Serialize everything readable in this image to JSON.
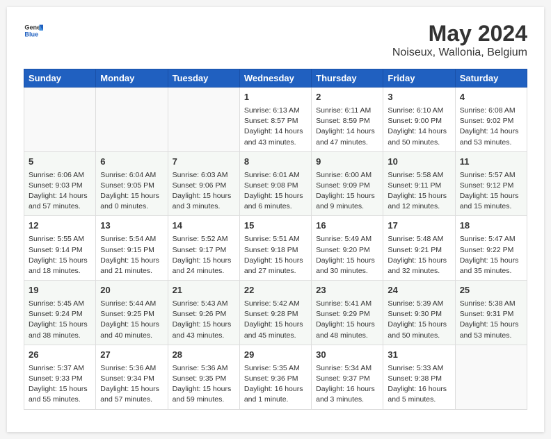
{
  "header": {
    "logo_general": "General",
    "logo_blue": "Blue",
    "title": "May 2024",
    "subtitle": "Noiseux, Wallonia, Belgium"
  },
  "days_of_week": [
    "Sunday",
    "Monday",
    "Tuesday",
    "Wednesday",
    "Thursday",
    "Friday",
    "Saturday"
  ],
  "weeks": [
    {
      "cells": [
        {
          "empty": true
        },
        {
          "empty": true
        },
        {
          "empty": true
        },
        {
          "day": 1,
          "sunrise": "6:13 AM",
          "sunset": "8:57 PM",
          "daylight": "14 hours and 43 minutes."
        },
        {
          "day": 2,
          "sunrise": "6:11 AM",
          "sunset": "8:59 PM",
          "daylight": "14 hours and 47 minutes."
        },
        {
          "day": 3,
          "sunrise": "6:10 AM",
          "sunset": "9:00 PM",
          "daylight": "14 hours and 50 minutes."
        },
        {
          "day": 4,
          "sunrise": "6:08 AM",
          "sunset": "9:02 PM",
          "daylight": "14 hours and 53 minutes."
        }
      ]
    },
    {
      "cells": [
        {
          "day": 5,
          "sunrise": "6:06 AM",
          "sunset": "9:03 PM",
          "daylight": "14 hours and 57 minutes."
        },
        {
          "day": 6,
          "sunrise": "6:04 AM",
          "sunset": "9:05 PM",
          "daylight": "15 hours and 0 minutes."
        },
        {
          "day": 7,
          "sunrise": "6:03 AM",
          "sunset": "9:06 PM",
          "daylight": "15 hours and 3 minutes."
        },
        {
          "day": 8,
          "sunrise": "6:01 AM",
          "sunset": "9:08 PM",
          "daylight": "15 hours and 6 minutes."
        },
        {
          "day": 9,
          "sunrise": "6:00 AM",
          "sunset": "9:09 PM",
          "daylight": "15 hours and 9 minutes."
        },
        {
          "day": 10,
          "sunrise": "5:58 AM",
          "sunset": "9:11 PM",
          "daylight": "15 hours and 12 minutes."
        },
        {
          "day": 11,
          "sunrise": "5:57 AM",
          "sunset": "9:12 PM",
          "daylight": "15 hours and 15 minutes."
        }
      ]
    },
    {
      "cells": [
        {
          "day": 12,
          "sunrise": "5:55 AM",
          "sunset": "9:14 PM",
          "daylight": "15 hours and 18 minutes."
        },
        {
          "day": 13,
          "sunrise": "5:54 AM",
          "sunset": "9:15 PM",
          "daylight": "15 hours and 21 minutes."
        },
        {
          "day": 14,
          "sunrise": "5:52 AM",
          "sunset": "9:17 PM",
          "daylight": "15 hours and 24 minutes."
        },
        {
          "day": 15,
          "sunrise": "5:51 AM",
          "sunset": "9:18 PM",
          "daylight": "15 hours and 27 minutes."
        },
        {
          "day": 16,
          "sunrise": "5:49 AM",
          "sunset": "9:20 PM",
          "daylight": "15 hours and 30 minutes."
        },
        {
          "day": 17,
          "sunrise": "5:48 AM",
          "sunset": "9:21 PM",
          "daylight": "15 hours and 32 minutes."
        },
        {
          "day": 18,
          "sunrise": "5:47 AM",
          "sunset": "9:22 PM",
          "daylight": "15 hours and 35 minutes."
        }
      ]
    },
    {
      "cells": [
        {
          "day": 19,
          "sunrise": "5:45 AM",
          "sunset": "9:24 PM",
          "daylight": "15 hours and 38 minutes."
        },
        {
          "day": 20,
          "sunrise": "5:44 AM",
          "sunset": "9:25 PM",
          "daylight": "15 hours and 40 minutes."
        },
        {
          "day": 21,
          "sunrise": "5:43 AM",
          "sunset": "9:26 PM",
          "daylight": "15 hours and 43 minutes."
        },
        {
          "day": 22,
          "sunrise": "5:42 AM",
          "sunset": "9:28 PM",
          "daylight": "15 hours and 45 minutes."
        },
        {
          "day": 23,
          "sunrise": "5:41 AM",
          "sunset": "9:29 PM",
          "daylight": "15 hours and 48 minutes."
        },
        {
          "day": 24,
          "sunrise": "5:39 AM",
          "sunset": "9:30 PM",
          "daylight": "15 hours and 50 minutes."
        },
        {
          "day": 25,
          "sunrise": "5:38 AM",
          "sunset": "9:31 PM",
          "daylight": "15 hours and 53 minutes."
        }
      ]
    },
    {
      "cells": [
        {
          "day": 26,
          "sunrise": "5:37 AM",
          "sunset": "9:33 PM",
          "daylight": "15 hours and 55 minutes."
        },
        {
          "day": 27,
          "sunrise": "5:36 AM",
          "sunset": "9:34 PM",
          "daylight": "15 hours and 57 minutes."
        },
        {
          "day": 28,
          "sunrise": "5:36 AM",
          "sunset": "9:35 PM",
          "daylight": "15 hours and 59 minutes."
        },
        {
          "day": 29,
          "sunrise": "5:35 AM",
          "sunset": "9:36 PM",
          "daylight": "16 hours and 1 minute."
        },
        {
          "day": 30,
          "sunrise": "5:34 AM",
          "sunset": "9:37 PM",
          "daylight": "16 hours and 3 minutes."
        },
        {
          "day": 31,
          "sunrise": "5:33 AM",
          "sunset": "9:38 PM",
          "daylight": "16 hours and 5 minutes."
        },
        {
          "empty": true
        }
      ]
    }
  ],
  "labels": {
    "sunrise_label": "Sunrise: ",
    "sunset_label": "Sunset: ",
    "daylight_label": "Daylight: "
  }
}
